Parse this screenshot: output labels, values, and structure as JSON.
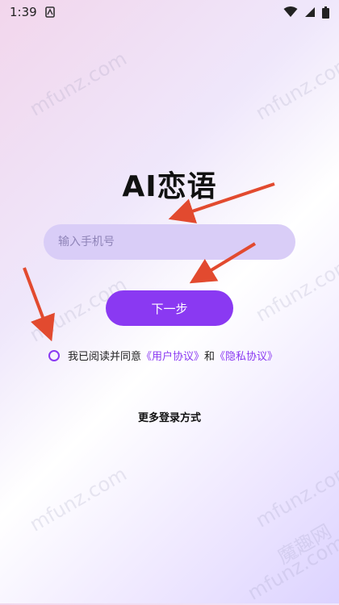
{
  "status_bar": {
    "time": "1:39"
  },
  "app_title": "AI恋语",
  "phone_input": {
    "placeholder": "输入手机号",
    "value": ""
  },
  "next_button": {
    "label": "下一步"
  },
  "agreement": {
    "text_prefix": "我已阅读并同意",
    "user_agreement": "《用户协议》",
    "conjunction": "和",
    "privacy_agreement": "《隐私协议》"
  },
  "more_login": "更多登录方式",
  "watermarks": [
    "mfunz.com",
    "mfunz.com",
    "mfunz.com",
    "mfunz.com",
    "mfunz.com",
    "mfunz.com",
    "mfunz.com",
    "魔趣网"
  ],
  "colors": {
    "accent": "#8a39f2",
    "input_bg": "#d9cdf7",
    "arrow": "#e24a2f"
  }
}
